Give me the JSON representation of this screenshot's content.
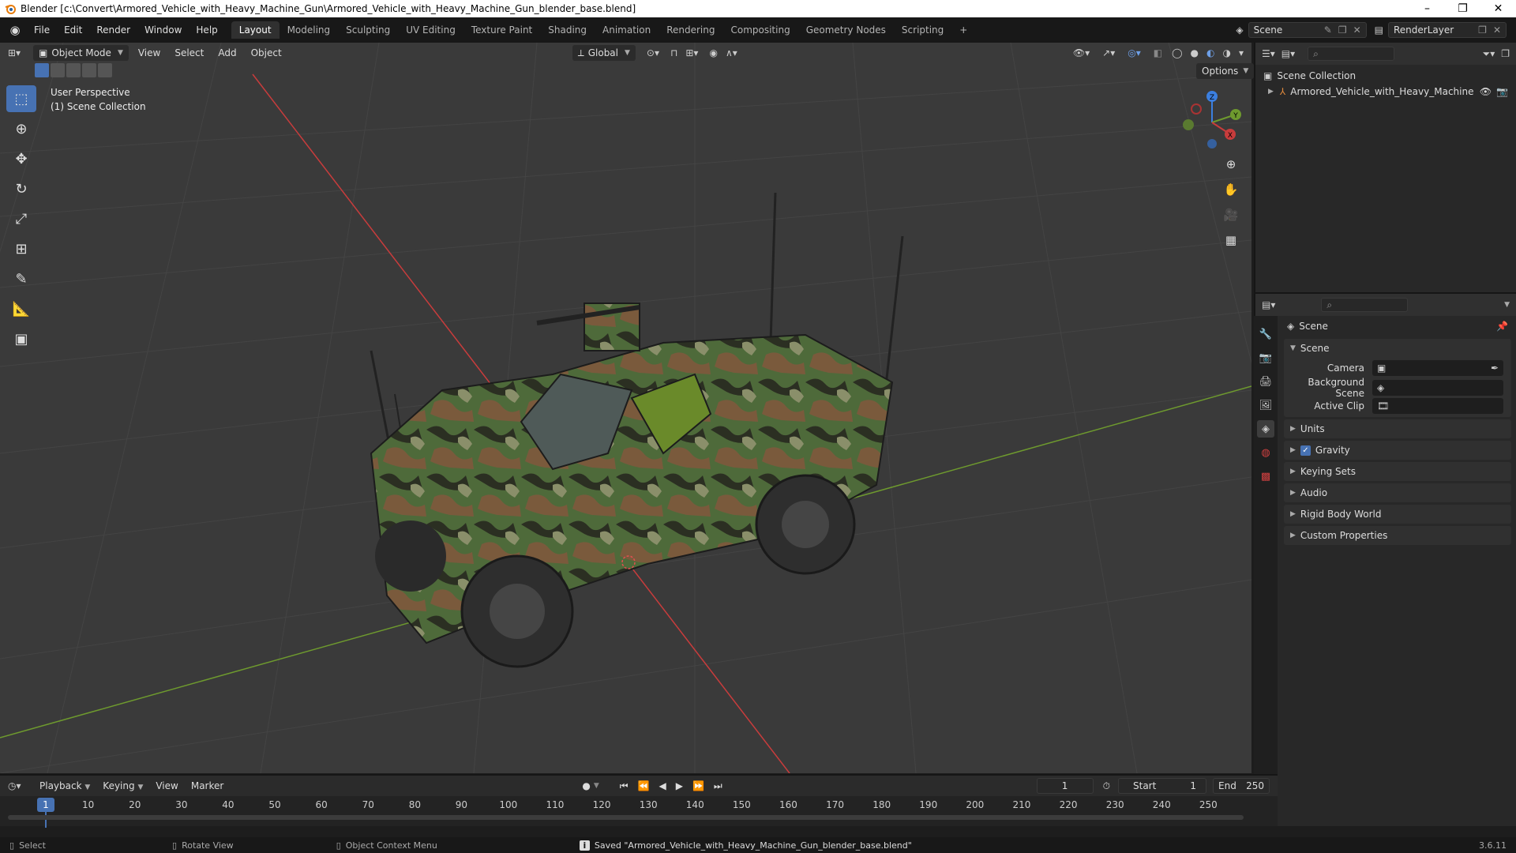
{
  "window": {
    "title": "Blender [c:\\Convert\\Armored_Vehicle_with_Heavy_Machine_Gun\\Armored_Vehicle_with_Heavy_Machine_Gun_blender_base.blend]",
    "controls": {
      "minimize": "–",
      "maximize": "❐",
      "close": "✕"
    }
  },
  "menu": {
    "items": [
      "File",
      "Edit",
      "Render",
      "Window",
      "Help"
    ]
  },
  "workspaces": {
    "tabs": [
      "Layout",
      "Modeling",
      "Sculpting",
      "UV Editing",
      "Texture Paint",
      "Shading",
      "Animation",
      "Rendering",
      "Compositing",
      "Geometry Nodes",
      "Scripting"
    ],
    "active": "Layout",
    "add_label": "+"
  },
  "scene_selector": {
    "value": "Scene"
  },
  "layer_selector": {
    "value": "RenderLayer"
  },
  "viewport": {
    "mode": "Object Mode",
    "menus": [
      "View",
      "Select",
      "Add",
      "Object"
    ],
    "transform_orientation": "Global",
    "options_label": "Options",
    "info_line1": "User Perspective",
    "info_line2": "(1) Scene Collection",
    "gizmo": {
      "x": "X",
      "y": "Y",
      "z": "Z"
    },
    "colors": {
      "background": "#3a3a3a",
      "x_axis": "#c83c3c",
      "y_axis": "#6e9a2e",
      "z_axis": "#3b7fe0",
      "active_tool": "#4772b3"
    }
  },
  "outliner": {
    "root": "Scene Collection",
    "items": [
      {
        "label": "Armored_Vehicle_with_Heavy_Machine"
      }
    ]
  },
  "properties": {
    "context_title": "Scene",
    "panel_scene": {
      "label": "Scene",
      "rows": [
        {
          "label": "Camera",
          "value": ""
        },
        {
          "label": "Background Scene",
          "value": ""
        },
        {
          "label": "Active Clip",
          "value": ""
        }
      ]
    },
    "collapsed_panels": [
      "Units",
      "Gravity",
      "Keying Sets",
      "Audio",
      "Rigid Body World",
      "Custom Properties"
    ],
    "gravity_checked": true
  },
  "timeline": {
    "menus": [
      "Playback",
      "Keying",
      "View",
      "Marker"
    ],
    "current_frame": "1",
    "start_label": "Start",
    "start": "1",
    "end_label": "End",
    "end": "250",
    "ruler_ticks": [
      "1",
      "10",
      "20",
      "30",
      "40",
      "50",
      "60",
      "70",
      "80",
      "90",
      "100",
      "110",
      "120",
      "130",
      "140",
      "150",
      "160",
      "170",
      "180",
      "190",
      "200",
      "210",
      "220",
      "230",
      "240",
      "250"
    ]
  },
  "statusbar": {
    "select": "Select",
    "rotate": "Rotate View",
    "context_menu": "Object Context Menu",
    "message": "Saved \"Armored_Vehicle_with_Heavy_Machine_Gun_blender_base.blend\"",
    "version": "3.6.11"
  }
}
